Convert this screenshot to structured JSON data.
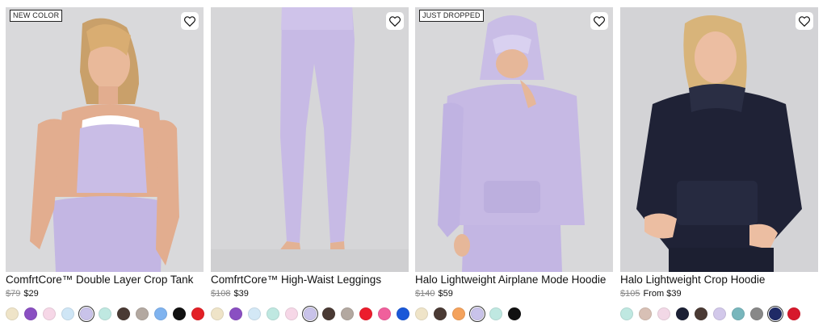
{
  "products": [
    {
      "badge": "NEW COLOR",
      "title": "ComfrtCore™ Double Layer Crop Tank",
      "old_price": "$79",
      "price": "$29",
      "swatches": [
        "#efe4c8",
        "#8a4fc2",
        "#f6d7e7",
        "#cfe6f6",
        "#c9c3ea",
        "#bfe8e1",
        "#4a3a34",
        "#b3a8a0",
        "#7fb3ef",
        "#111111",
        "#e32026"
      ]
    },
    {
      "badge": "",
      "title": "ComfrtCore™ High-Waist Leggings",
      "old_price": "$108",
      "price": "$39",
      "swatches": [
        "#efe4c8",
        "#8a4fc2",
        "#d3e8f6",
        "#bfe8e1",
        "#f6d7e7",
        "#c9c3ea",
        "#4a3a34",
        "#b3a8a0",
        "#ec1d2c",
        "#f0609c",
        "#1a58d8"
      ]
    },
    {
      "badge": "JUST DROPPED",
      "title": "Halo Lightweight Airplane Mode Hoodie",
      "old_price": "$140",
      "price": "$59",
      "swatches": [
        "#efe4c8",
        "#4a3a34",
        "#f4a25c",
        "#c9c3ea",
        "#bfe8e1",
        "#111111"
      ]
    },
    {
      "badge": "",
      "title": "Halo Lightweight Crop Hoodie",
      "old_price": "$105",
      "price": "From $39",
      "swatches": [
        "#bfe8e1",
        "#d8c0b5",
        "#f2d8e6",
        "#1b2035",
        "#4a3a34",
        "#d2c8ea",
        "#78b6bc",
        "#888888",
        "#1f2a66",
        "#d7192c"
      ]
    }
  ],
  "icons": {
    "wishlist": "heart-outline-icon"
  }
}
